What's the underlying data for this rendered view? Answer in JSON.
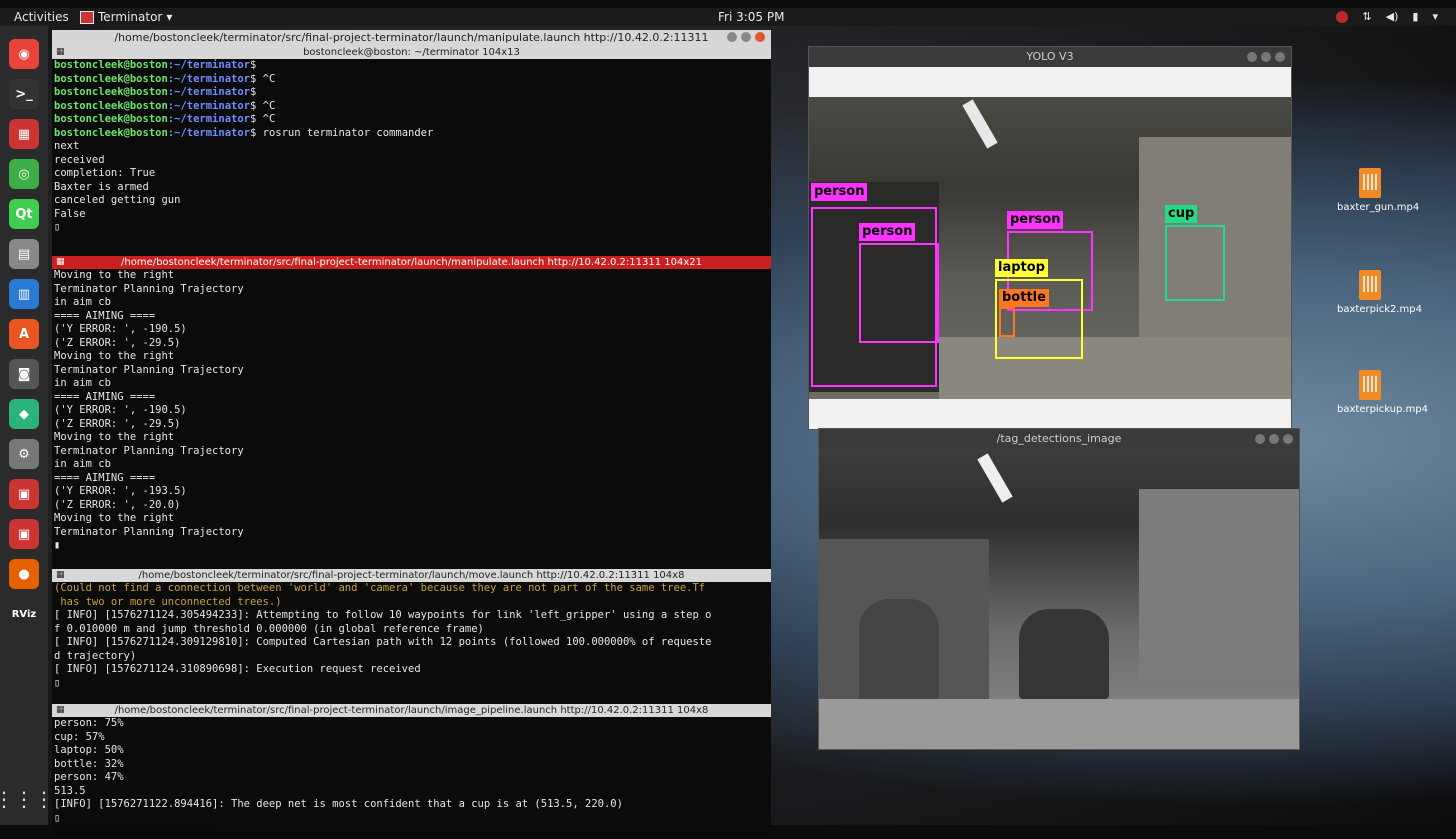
{
  "topbar": {
    "activities": "Activities",
    "app_name": "Terminator",
    "clock": "Fri  3:05 PM"
  },
  "dock": {
    "apps": [
      {
        "name": "chrome-icon",
        "color": "#e8443a",
        "glyph": "◉"
      },
      {
        "name": "terminal-icon",
        "color": "#333",
        "glyph": ">_"
      },
      {
        "name": "terminator-icon",
        "color": "#c33",
        "glyph": "▦"
      },
      {
        "name": "web-icon",
        "color": "#3dae49",
        "glyph": "◎"
      },
      {
        "name": "qt-icon",
        "color": "#41cd52",
        "glyph": "Qt"
      },
      {
        "name": "files-icon",
        "color": "#888",
        "glyph": "▤"
      },
      {
        "name": "writer-icon",
        "color": "#2a7ad3",
        "glyph": "▥"
      },
      {
        "name": "software-icon",
        "color": "#e95420",
        "glyph": "A"
      },
      {
        "name": "camera-icon",
        "color": "#555",
        "glyph": "◙"
      },
      {
        "name": "maps-icon",
        "color": "#2bb37a",
        "glyph": "◆"
      },
      {
        "name": "settings-icon",
        "color": "#777",
        "glyph": "⚙"
      },
      {
        "name": "terminator-2-icon",
        "color": "#c33",
        "glyph": "▣"
      },
      {
        "name": "terminator-3-icon",
        "color": "#c33",
        "glyph": "▣"
      },
      {
        "name": "firefox-icon",
        "color": "#e66000",
        "glyph": "●"
      },
      {
        "name": "rviz-icon",
        "color": "#2b2b2b",
        "glyph": "RViz"
      }
    ],
    "apps_grid": "⋮⋮⋮"
  },
  "terminator_window": {
    "title": "/home/bostoncleek/terminator/src/final-project-terminator/launch/manipulate.launch http://10.42.0.2:11311",
    "panes": [
      {
        "title": "bostoncleek@boston: ~/terminator 104x13",
        "active": false,
        "lines": [
          {
            "user": "bostoncleek@boston",
            "path": ":~/terminator",
            "rest": "$"
          },
          {
            "user": "bostoncleek@boston",
            "path": ":~/terminator",
            "rest": "$ ^C"
          },
          {
            "user": "bostoncleek@boston",
            "path": ":~/terminator",
            "rest": "$"
          },
          {
            "user": "bostoncleek@boston",
            "path": ":~/terminator",
            "rest": "$ ^C"
          },
          {
            "user": "bostoncleek@boston",
            "path": ":~/terminator",
            "rest": "$ ^C"
          },
          {
            "user": "bostoncleek@boston",
            "path": ":~/terminator",
            "rest": "$ rosrun terminator commander"
          },
          {
            "text": "next"
          },
          {
            "text": "received"
          },
          {
            "text": "completion: True"
          },
          {
            "text": "Baxter is armed"
          },
          {
            "text": "canceled getting gun"
          },
          {
            "text": "False"
          },
          {
            "text": "▯"
          }
        ]
      },
      {
        "title": "/home/bostoncleek/terminator/src/final-project-terminator/launch/manipulate.launch http://10.42.0.2:11311 104x21",
        "active": true,
        "lines": [
          {
            "text": "Moving to the right"
          },
          {
            "text": "Terminator Planning Trajectory"
          },
          {
            "text": "in aim cb"
          },
          {
            "text": "==== AIMING ===="
          },
          {
            "text": "('Y ERROR: ', -190.5)"
          },
          {
            "text": "('Z ERROR: ', -29.5)"
          },
          {
            "text": "Moving to the right"
          },
          {
            "text": "Terminator Planning Trajectory"
          },
          {
            "text": "in aim cb"
          },
          {
            "text": "==== AIMING ===="
          },
          {
            "text": "('Y ERROR: ', -190.5)"
          },
          {
            "text": "('Z ERROR: ', -29.5)"
          },
          {
            "text": "Moving to the right"
          },
          {
            "text": "Terminator Planning Trajectory"
          },
          {
            "text": "in aim cb"
          },
          {
            "text": "==== AIMING ===="
          },
          {
            "text": "('Y ERROR: ', -193.5)"
          },
          {
            "text": "('Z ERROR: ', -20.0)"
          },
          {
            "text": "Moving to the right"
          },
          {
            "text": "Terminator Planning Trajectory"
          },
          {
            "text": "▮"
          }
        ]
      },
      {
        "title": "/home/bostoncleek/terminator/src/final-project-terminator/launch/move.launch http://10.42.0.2:11311 104x8",
        "active": false,
        "lines": [
          {
            "warn": true,
            "text": "(Could not find a connection between 'world' and 'camera' because they are not part of the same tree.Tf"
          },
          {
            "warn": true,
            "text": " has two or more unconnected trees.)"
          },
          {
            "text": "[ INFO] [1576271124.305494233]: Attempting to follow 10 waypoints for link 'left_gripper' using a step o"
          },
          {
            "text": "f 0.010000 m and jump threshold 0.000000 (in global reference frame)"
          },
          {
            "text": "[ INFO] [1576271124.309129810]: Computed Cartesian path with 12 points (followed 100.000000% of requeste"
          },
          {
            "text": "d trajectory)"
          },
          {
            "text": "[ INFO] [1576271124.310890698]: Execution request received"
          },
          {
            "text": "▯"
          }
        ]
      },
      {
        "title": "/home/bostoncleek/terminator/src/final-project-terminator/launch/image_pipeline.launch http://10.42.0.2:11311 104x8",
        "active": false,
        "lines": [
          {
            "text": "person: 75%"
          },
          {
            "text": "cup: 57%"
          },
          {
            "text": "laptop: 50%"
          },
          {
            "text": "bottle: 32%"
          },
          {
            "text": "person: 47%"
          },
          {
            "text": "513.5"
          },
          {
            "text": "[INFO] [1576271122.894416]: The deep net is most confident that a cup is at (513.5, 220.0)"
          },
          {
            "text": "▯"
          }
        ]
      }
    ]
  },
  "yolo_window": {
    "title": "YOLO V3",
    "detections": [
      {
        "label": "person",
        "color": "#ff33ff"
      },
      {
        "label": "person",
        "color": "#ff33ff"
      },
      {
        "label": "person",
        "color": "#ff33ff"
      },
      {
        "label": "cup",
        "color": "#22dd88"
      },
      {
        "label": "laptop",
        "color": "#ffff33"
      },
      {
        "label": "bottle",
        "color": "#ff7722"
      }
    ]
  },
  "tag_window": {
    "title": "/tag_detections_image"
  },
  "desktop_files": [
    {
      "name": "baxter_gun.mp4"
    },
    {
      "name": "baxterpick2.mp4"
    },
    {
      "name": "baxterpickup.mp4"
    }
  ]
}
